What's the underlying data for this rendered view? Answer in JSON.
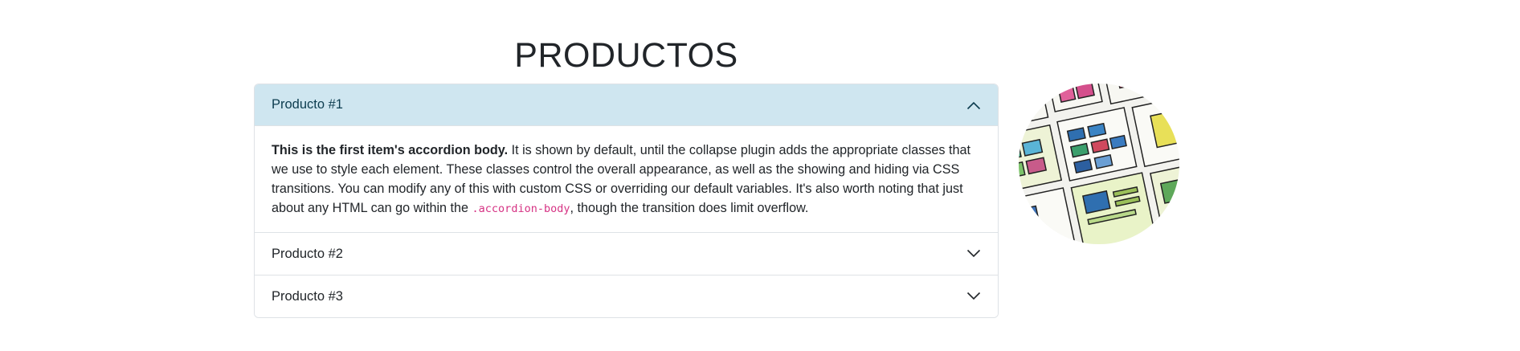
{
  "page": {
    "title": "PRODUCTOS"
  },
  "accordion": {
    "items": [
      {
        "label": "Producto #1",
        "expanded": true,
        "body_strong": "This is the first item's accordion body.",
        "body_text": " It is shown by default, until the collapse plugin adds the appropriate classes that we use to style each element. These classes control the overall appearance, as well as the showing and hiding via CSS transitions. You can modify any of this with custom CSS or overriding our default variables. It's also worth noting that just about any HTML can go within the ",
        "body_code": ".accordion-body",
        "body_tail": ", though the transition does limit overflow."
      },
      {
        "label": "Producto #2",
        "expanded": false
      },
      {
        "label": "Producto #3",
        "expanded": false
      }
    ]
  },
  "colors": {
    "active_header_bg": "#cfe6f0",
    "active_header_text": "#0c3c4f",
    "code_text": "#d63384",
    "border": "#dee2e6"
  },
  "icons": {
    "expanded": "chevron-up-icon",
    "collapsed": "chevron-down-icon"
  }
}
